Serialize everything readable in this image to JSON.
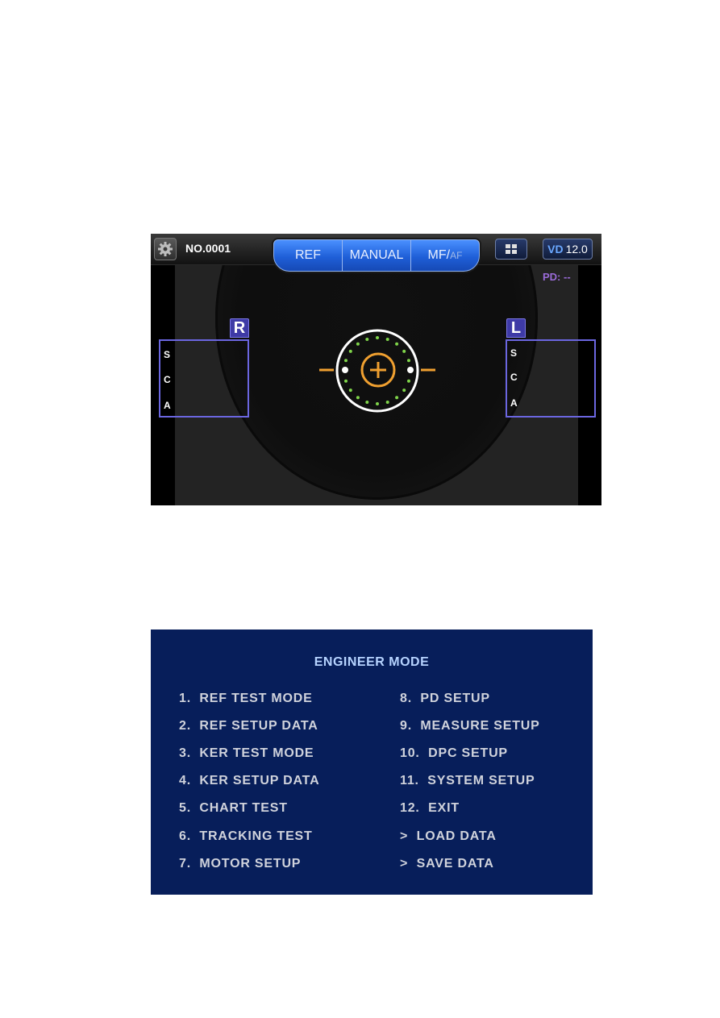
{
  "measurement_screen": {
    "patient_number": "NO.0001",
    "mode_buttons": [
      {
        "label": "REF"
      },
      {
        "label": "MANUAL"
      },
      {
        "label": "MF/",
        "sub_label": "AF"
      }
    ],
    "grid_icon": "grid-icon",
    "settings_icon": "gear-icon",
    "vd": {
      "label": "VD",
      "value": "12.0"
    },
    "pd": "PD: --",
    "right_eye": {
      "tag": "R",
      "rows": [
        "S",
        "C",
        "A"
      ]
    },
    "left_eye": {
      "tag": "L",
      "rows": [
        "S",
        "C",
        "A"
      ]
    },
    "colors": {
      "accent_blue": "#2a6ee8",
      "eye_box": "#6b66e0",
      "target_orange": "#f0a030",
      "ring_dots": "#7fd44a",
      "pd_text": "#9a6bd8"
    }
  },
  "engineer_mode": {
    "title": "ENGINEER MODE",
    "left_column": [
      "1.  REF TEST MODE",
      "2.  REF SETUP DATA",
      "3.  KER TEST MODE",
      "4.  KER SETUP DATA",
      "5.  CHART TEST",
      "6.  TRACKING TEST",
      "7.  MOTOR SETUP"
    ],
    "right_column": [
      "8.  PD SETUP",
      "9.  MEASURE SETUP",
      "10.  DPC SETUP",
      "11.  SYSTEM SETUP",
      "12.  EXIT",
      ">  LOAD DATA",
      ">  SAVE DATA"
    ],
    "colors": {
      "background": "#071e5a",
      "title": "#b6d3ff",
      "item_text": "#d0d3dc"
    }
  }
}
